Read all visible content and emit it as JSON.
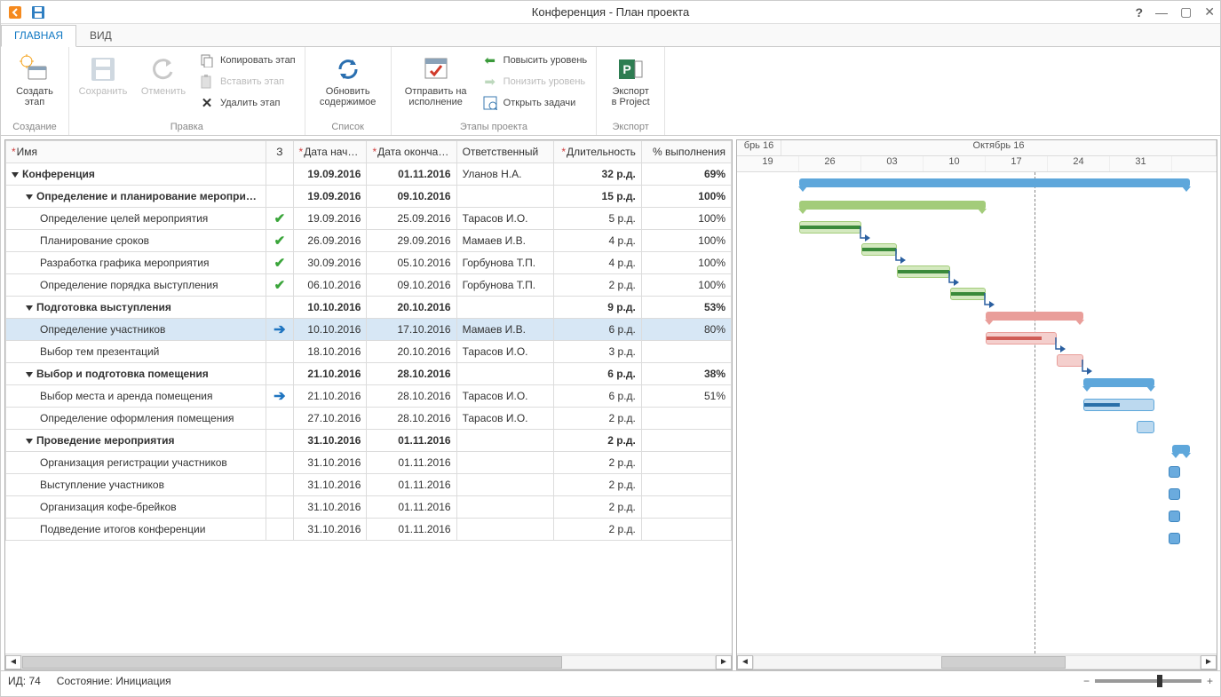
{
  "title": "Конференция - План проекта",
  "tabs": {
    "main": "ГЛАВНАЯ",
    "view": "ВИД"
  },
  "ribbon": {
    "create": {
      "label": "Создать\nэтап",
      "group": "Создание"
    },
    "edit": {
      "save": "Сохранить",
      "undo": "Отменить",
      "copy": "Копировать этап",
      "paste": "Вставить этап",
      "delete": "Удалить этап",
      "group": "Правка"
    },
    "list": {
      "refresh": "Обновить\nсодержимое",
      "group": "Список"
    },
    "stages": {
      "send": "Отправить на\nисполнение",
      "up": "Повысить уровень",
      "down": "Понизить уровень",
      "open": "Открыть задачи",
      "group": "Этапы проекта"
    },
    "export": {
      "label": "Экспорт\nв Project",
      "group": "Экспорт"
    }
  },
  "columns": {
    "name": "Имя",
    "status": "З",
    "start": "Дата начала",
    "end": "Дата окончания",
    "resp": "Ответственный",
    "dur": "Длительность",
    "pct": "% выполнения"
  },
  "rows": [
    {
      "lvl": 0,
      "sum": true,
      "name": "Конференция",
      "start": "19.09.2016",
      "end": "01.11.2016",
      "resp": "Уланов Н.А.",
      "dur": "32 р.д.",
      "pct": "69%"
    },
    {
      "lvl": 1,
      "sum": true,
      "name": "Определение и планирование мероприятия",
      "start": "19.09.2016",
      "end": "09.10.2016",
      "resp": "",
      "dur": "15 р.д.",
      "pct": "100%"
    },
    {
      "lvl": 2,
      "name": "Определение целей мероприятия",
      "status": "done",
      "start": "19.09.2016",
      "end": "25.09.2016",
      "resp": "Тарасов И.О.",
      "dur": "5 р.д.",
      "pct": "100%"
    },
    {
      "lvl": 2,
      "name": "Планирование сроков",
      "status": "done",
      "start": "26.09.2016",
      "end": "29.09.2016",
      "resp": "Мамаев И.В.",
      "dur": "4 р.д.",
      "pct": "100%"
    },
    {
      "lvl": 2,
      "name": "Разработка графика мероприятия",
      "status": "done",
      "start": "30.09.2016",
      "end": "05.10.2016",
      "resp": "Горбунова Т.П.",
      "dur": "4 р.д.",
      "pct": "100%"
    },
    {
      "lvl": 2,
      "name": "Определение порядка выступления",
      "status": "done",
      "start": "06.10.2016",
      "end": "09.10.2016",
      "resp": "Горбунова Т.П.",
      "dur": "2 р.д.",
      "pct": "100%"
    },
    {
      "lvl": 1,
      "sum": true,
      "name": "Подготовка выступления",
      "start": "10.10.2016",
      "end": "20.10.2016",
      "resp": "",
      "dur": "9 р.д.",
      "pct": "53%"
    },
    {
      "lvl": 2,
      "sel": true,
      "name": "Определение участников",
      "status": "active",
      "start": "10.10.2016",
      "end": "17.10.2016",
      "resp": "Мамаев И.В.",
      "dur": "6 р.д.",
      "pct": "80%"
    },
    {
      "lvl": 2,
      "name": "Выбор тем презентаций",
      "start": "18.10.2016",
      "end": "20.10.2016",
      "resp": "Тарасов И.О.",
      "dur": "3 р.д.",
      "pct": ""
    },
    {
      "lvl": 1,
      "sum": true,
      "name": "Выбор и подготовка помещения",
      "start": "21.10.2016",
      "end": "28.10.2016",
      "resp": "",
      "dur": "6 р.д.",
      "pct": "38%"
    },
    {
      "lvl": 2,
      "name": "Выбор места и аренда помещения",
      "status": "active",
      "start": "21.10.2016",
      "end": "28.10.2016",
      "resp": "Тарасов И.О.",
      "dur": "6 р.д.",
      "pct": "51%"
    },
    {
      "lvl": 2,
      "name": "Определение оформления помещения",
      "start": "27.10.2016",
      "end": "28.10.2016",
      "resp": "Тарасов И.О.",
      "dur": "2 р.д.",
      "pct": ""
    },
    {
      "lvl": 1,
      "sum": true,
      "name": "Проведение мероприятия",
      "start": "31.10.2016",
      "end": "01.11.2016",
      "resp": "",
      "dur": "2 р.д.",
      "pct": ""
    },
    {
      "lvl": 2,
      "name": "Организация регистрации участников",
      "start": "31.10.2016",
      "end": "01.11.2016",
      "resp": "",
      "dur": "2 р.д.",
      "pct": ""
    },
    {
      "lvl": 2,
      "name": "Выступление участников",
      "start": "31.10.2016",
      "end": "01.11.2016",
      "resp": "",
      "dur": "2 р.д.",
      "pct": ""
    },
    {
      "lvl": 2,
      "name": "Организация кофе-брейков",
      "start": "31.10.2016",
      "end": "01.11.2016",
      "resp": "",
      "dur": "2 р.д.",
      "pct": ""
    },
    {
      "lvl": 2,
      "name": "Подведение итогов конференции",
      "start": "31.10.2016",
      "end": "01.11.2016",
      "resp": "",
      "dur": "2 р.д.",
      "pct": ""
    }
  ],
  "timeline": {
    "month1": "брь 16",
    "month2": "Октябрь 16",
    "weeks": [
      "19",
      "26",
      "03",
      "10",
      "17",
      "24",
      "31"
    ]
  },
  "statusbar": {
    "id_lbl": "ИД:",
    "id": "74",
    "state_lbl": "Состояние:",
    "state": "Инициация"
  }
}
